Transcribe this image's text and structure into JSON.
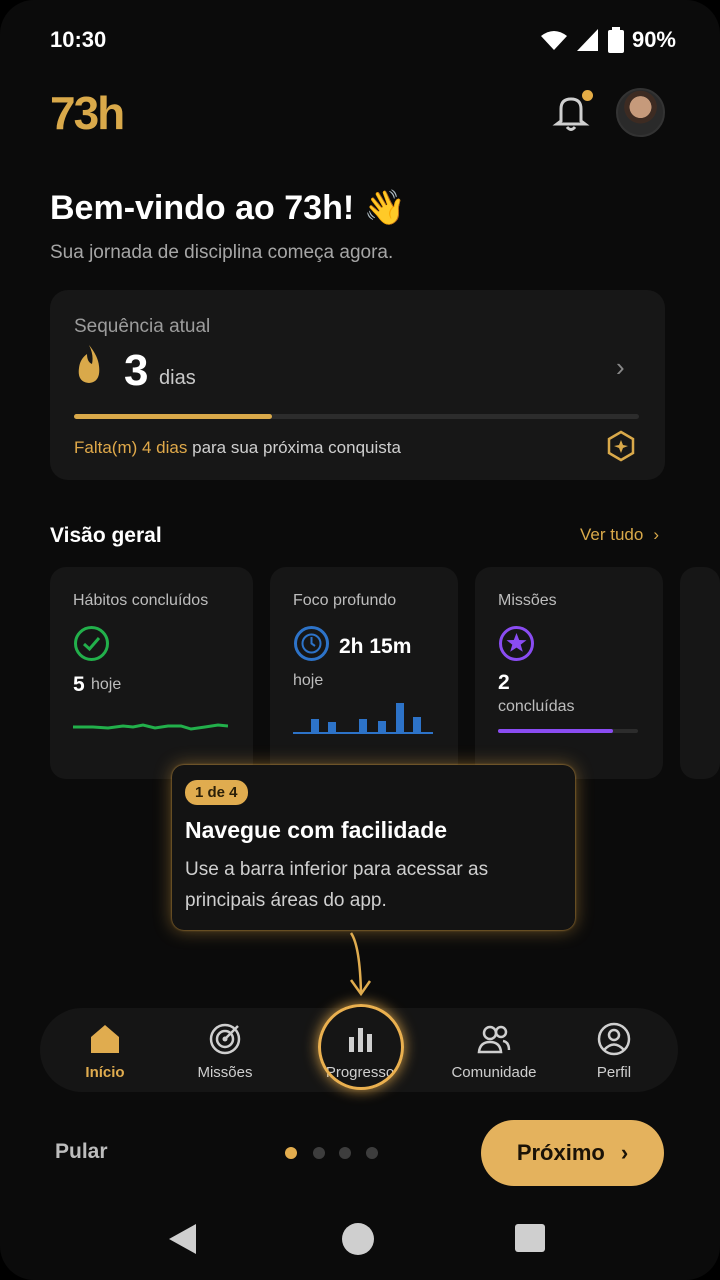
{
  "status_bar": {
    "time": "10:30",
    "battery": "90%"
  },
  "header": {
    "logo": "73h"
  },
  "welcome": {
    "title": "Bem-vindo ao 73h! 👋",
    "subtitle": "Sua jornada de disciplina começa agora."
  },
  "streak": {
    "label": "Sequência atual",
    "value": "3",
    "unit": "dias",
    "progress": 0.35,
    "foot_highlight": "Falta(m) 4 dias",
    "foot_text": "para sua próxima conquista"
  },
  "overview": {
    "title": "Visão geral",
    "see_all": "Ver tudo"
  },
  "stats": [
    {
      "title": "Hábitos concluídos",
      "value": "5",
      "sub": "hoje"
    },
    {
      "title": "Foco profundo",
      "value": "2h 15m",
      "sub": "hoje"
    },
    {
      "title": "Missões",
      "value": "2",
      "sub": "concluídas",
      "progress": 0.82
    }
  ],
  "tooltip": {
    "step": "1 de 4",
    "title": "Navegue com facilidade",
    "text": "Use a barra inferior para acessar as principais áreas do app."
  },
  "nav": {
    "items": [
      {
        "label": "Início"
      },
      {
        "label": "Missões"
      },
      {
        "label": "Progresso"
      },
      {
        "label": "Comunidade"
      },
      {
        "label": "Perfil"
      }
    ]
  },
  "footer": {
    "skip": "Pular",
    "next": "Próximo"
  },
  "colors": {
    "accent": "#D9A94A",
    "green": "#22B04B",
    "blue": "#2D73C8",
    "purple": "#8A4CF2"
  }
}
